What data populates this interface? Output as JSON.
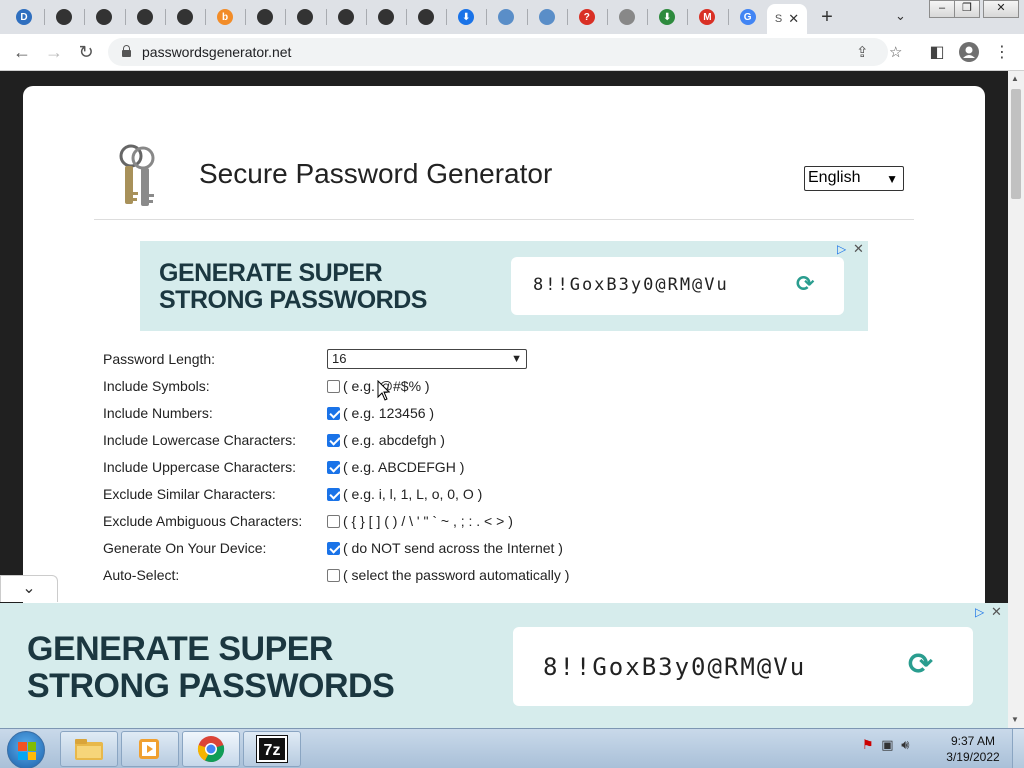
{
  "browser": {
    "tabs": [
      {
        "name": "dell",
        "color": "#2f6fbf",
        "glyph": "D"
      },
      {
        "name": "github",
        "color": "#333",
        "glyph": ""
      },
      {
        "name": "github",
        "color": "#333",
        "glyph": ""
      },
      {
        "name": "github",
        "color": "#333",
        "glyph": ""
      },
      {
        "name": "github",
        "color": "#333",
        "glyph": ""
      },
      {
        "name": "bitnami",
        "color": "#f28c28",
        "glyph": "b"
      },
      {
        "name": "github",
        "color": "#333",
        "glyph": ""
      },
      {
        "name": "github",
        "color": "#333",
        "glyph": ""
      },
      {
        "name": "github",
        "color": "#333",
        "glyph": ""
      },
      {
        "name": "github",
        "color": "#333",
        "glyph": ""
      },
      {
        "name": "github",
        "color": "#333",
        "glyph": ""
      },
      {
        "name": "download",
        "color": "#1a73e8",
        "glyph": "⬇"
      },
      {
        "name": "globe",
        "color": "#5a8ec8",
        "glyph": ""
      },
      {
        "name": "globe",
        "color": "#5a8ec8",
        "glyph": ""
      },
      {
        "name": "help",
        "color": "#d93025",
        "glyph": "?"
      },
      {
        "name": "web",
        "color": "#888",
        "glyph": ""
      },
      {
        "name": "download-green",
        "color": "#2e8b3e",
        "glyph": "⬇"
      },
      {
        "name": "mail",
        "color": "#d93025",
        "glyph": "M"
      },
      {
        "name": "google",
        "color": "#4285f4",
        "glyph": "G"
      }
    ],
    "active_tab_letter": "S",
    "url": "passwordsgenerator.net"
  },
  "page": {
    "title": "Secure Password Generator",
    "language": "English",
    "ad": {
      "headline_line1": "GENERATE SUPER",
      "headline_line2": "STRONG PASSWORDS",
      "sample_password": "8!!GoxB3y0@RM@Vu"
    },
    "form": [
      {
        "label": "Password Length:",
        "type": "select",
        "value": "16"
      },
      {
        "label": "Include Symbols:",
        "type": "checkbox",
        "checked": false,
        "hint": "( e.g. @#$% )"
      },
      {
        "label": "Include Numbers:",
        "type": "checkbox",
        "checked": true,
        "hint": "( e.g. 123456 )"
      },
      {
        "label": "Include Lowercase Characters:",
        "type": "checkbox",
        "checked": true,
        "hint": "( e.g. abcdefgh )"
      },
      {
        "label": "Include Uppercase Characters:",
        "type": "checkbox",
        "checked": true,
        "hint": "( e.g. ABCDEFGH )"
      },
      {
        "label": "Exclude Similar Characters:",
        "type": "checkbox",
        "checked": true,
        "hint": "( e.g. i, l, 1, L, o, 0, O )"
      },
      {
        "label": "Exclude Ambiguous Characters:",
        "type": "checkbox",
        "checked": false,
        "hint": "( { } [ ] ( ) / \\ ' \" ` ~ , ; : . < > )"
      },
      {
        "label": "Generate On Your Device:",
        "type": "checkbox",
        "checked": true,
        "hint": "( do NOT send across the Internet )"
      },
      {
        "label": "Auto-Select:",
        "type": "checkbox",
        "checked": false,
        "hint": "( select the password automatically )"
      }
    ]
  },
  "taskbar": {
    "time": "9:37 AM",
    "date": "3/19/2022"
  },
  "colors": {
    "ad_background": "#d6ecec",
    "ad_headline": "#1b3740",
    "checkbox_on": "#1a73e8",
    "refresh": "#2a9d8f"
  }
}
